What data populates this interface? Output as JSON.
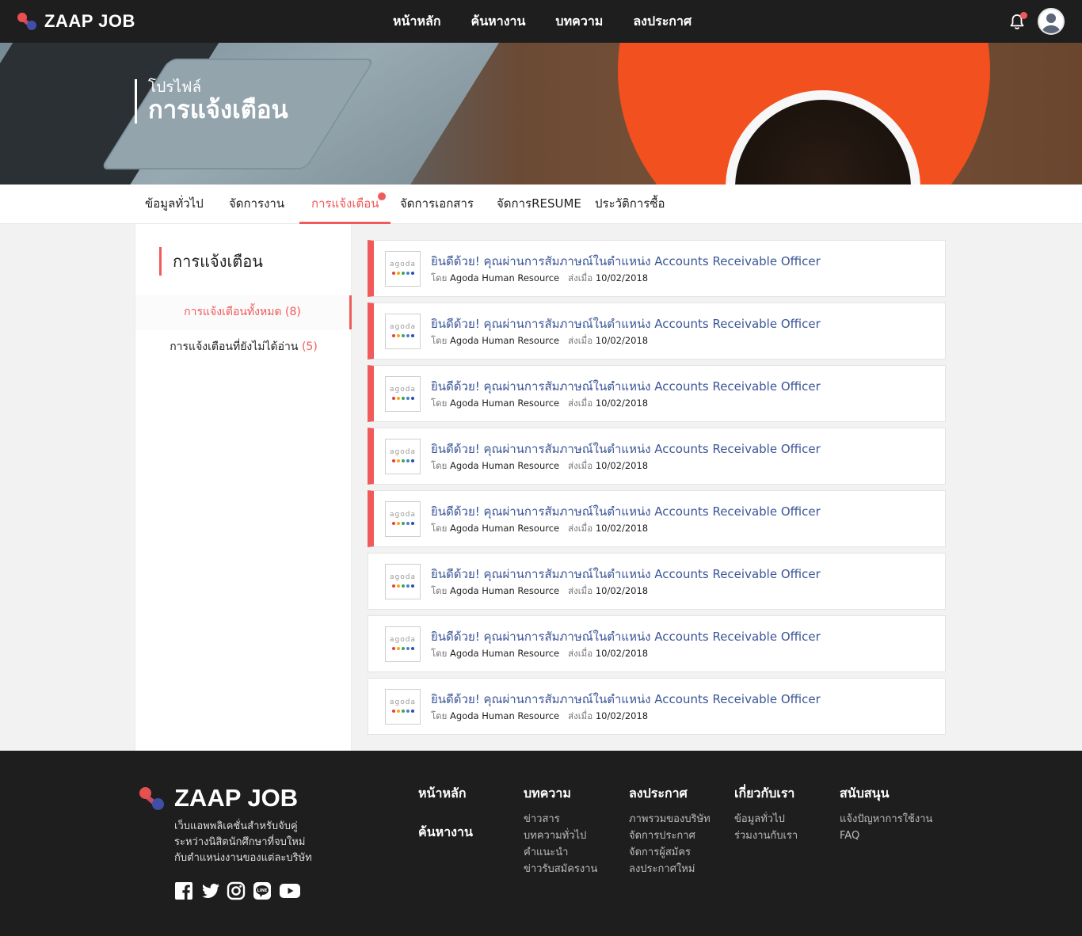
{
  "brand": {
    "name": "ZAAP JOB"
  },
  "topnav": {
    "links": [
      "หน้าหลัก",
      "ค้นหางาน",
      "บทความ",
      "ลงประกาศ"
    ],
    "icons": [
      "bell-icon",
      "avatar"
    ]
  },
  "hero": {
    "subtitle": "โปรไฟล์",
    "title": "การแจ้งเตือน"
  },
  "tabs": [
    {
      "label": "ข้อมูลทั่วไป",
      "active": false
    },
    {
      "label": "จัดการงาน",
      "active": false
    },
    {
      "label": "การแจ้งเตือน",
      "active": true
    },
    {
      "label": "จัดการเอกสาร",
      "active": false
    },
    {
      "label": "จัดการRESUME",
      "active": false
    },
    {
      "label": "ประวัติการซื้อ",
      "active": false
    }
  ],
  "sidebar": {
    "title": "การแจ้งเตือน",
    "items": [
      {
        "label": "การแจ้งเตือนทั้งหมด",
        "count": "(8)",
        "active": true
      },
      {
        "label": "การแจ้งเตือนที่ยังไม่ได้อ่าน",
        "count": "(5)",
        "active": false
      }
    ]
  },
  "notifications": [
    {
      "title": "ยินดีด้วย! คุณผ่านการสัมภาษณ์ในตำแหน่ง Accounts Receivable Officer",
      "by_label": "โดย",
      "sender": "Agoda Human Resource",
      "sent_label": "ส่งเมื่อ",
      "date": "10/02/2018",
      "logo_text": "agoda",
      "unread": true
    },
    {
      "title": "ยินดีด้วย! คุณผ่านการสัมภาษณ์ในตำแหน่ง Accounts Receivable Officer",
      "by_label": "โดย",
      "sender": "Agoda Human Resource",
      "sent_label": "ส่งเมื่อ",
      "date": "10/02/2018",
      "logo_text": "agoda",
      "unread": true
    },
    {
      "title": "ยินดีด้วย! คุณผ่านการสัมภาษณ์ในตำแหน่ง Accounts Receivable Officer",
      "by_label": "โดย",
      "sender": "Agoda Human Resource",
      "sent_label": "ส่งเมื่อ",
      "date": "10/02/2018",
      "logo_text": "agoda",
      "unread": true
    },
    {
      "title": "ยินดีด้วย! คุณผ่านการสัมภาษณ์ในตำแหน่ง Accounts Receivable Officer",
      "by_label": "โดย",
      "sender": "Agoda Human Resource",
      "sent_label": "ส่งเมื่อ",
      "date": "10/02/2018",
      "logo_text": "agoda",
      "unread": true
    },
    {
      "title": "ยินดีด้วย! คุณผ่านการสัมภาษณ์ในตำแหน่ง Accounts Receivable Officer",
      "by_label": "โดย",
      "sender": "Agoda Human Resource",
      "sent_label": "ส่งเมื่อ",
      "date": "10/02/2018",
      "logo_text": "agoda",
      "unread": true
    },
    {
      "title": "ยินดีด้วย! คุณผ่านการสัมภาษณ์ในตำแหน่ง Accounts Receivable Officer",
      "by_label": "โดย",
      "sender": "Agoda Human Resource",
      "sent_label": "ส่งเมื่อ",
      "date": "10/02/2018",
      "logo_text": "agoda",
      "unread": false
    },
    {
      "title": "ยินดีด้วย! คุณผ่านการสัมภาษณ์ในตำแหน่ง Accounts Receivable Officer",
      "by_label": "โดย",
      "sender": "Agoda Human Resource",
      "sent_label": "ส่งเมื่อ",
      "date": "10/02/2018",
      "logo_text": "agoda",
      "unread": false
    },
    {
      "title": "ยินดีด้วย! คุณผ่านการสัมภาษณ์ในตำแหน่ง Accounts Receivable Officer",
      "by_label": "โดย",
      "sender": "Agoda Human Resource",
      "sent_label": "ส่งเมื่อ",
      "date": "10/02/2018",
      "logo_text": "agoda",
      "unread": false
    }
  ],
  "footer": {
    "brand": "ZAAP JOB",
    "description": [
      "เว็บแอพพลิเคชั่นสำหรับจับคู่",
      "ระหว่างนิสิตนักศึกษาที่จบใหม่",
      "กับตำแหน่งงานของแต่ละบริษัท"
    ],
    "socials": [
      "facebook-icon",
      "twitter-icon",
      "instagram-icon",
      "line-icon",
      "youtube-icon"
    ],
    "main_links": [
      "หน้าหลัก",
      "ค้นหางาน"
    ],
    "columns": [
      {
        "heading": "บทความ",
        "links": [
          "ข่าวสาร",
          "บทความทั่วไป",
          "คำแนะนำ",
          "ข่าวรับสมัครงาน"
        ]
      },
      {
        "heading": "ลงประกาศ",
        "links": [
          "ภาพรวมของบริษัท",
          "จัดการประกาศ",
          "จัดการผู้สมัคร",
          "ลงประกาศใหม่"
        ]
      },
      {
        "heading": "เกี่ยวกับเรา",
        "links": [
          "ข้อมูลทั่วไป",
          "ร่วมงานกับเรา"
        ]
      },
      {
        "heading": "สนับสนุน",
        "links": [
          "แจ้งปัญหาการใช้งาน",
          "FAQ"
        ]
      }
    ]
  },
  "colors": {
    "accent": "#f05a5a",
    "link": "#3a5596",
    "dark": "#1e1e1e"
  }
}
